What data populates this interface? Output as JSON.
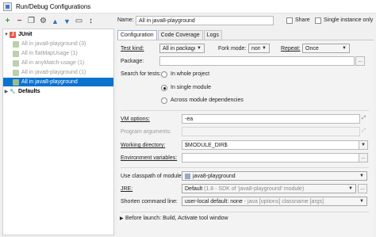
{
  "window": {
    "title": "Run/Debug Configurations"
  },
  "toolbar": {
    "add_glyph": "+",
    "remove_glyph": "−",
    "copy_glyph": "❐",
    "settings_glyph": "⚙",
    "up_glyph": "▲",
    "down_glyph": "▼",
    "folder_glyph": "▭",
    "sort_glyph": "↕"
  },
  "tree": {
    "junit_label": "JUnit",
    "items": [
      "All in java8-playground (3)",
      "All in flatMapUsage (1)",
      "All in anyMatch-usage (1)",
      "All in java8-playground (1)",
      "All in java8-playground"
    ],
    "defaults_label": "Defaults"
  },
  "header": {
    "name_label": "Name:",
    "name_value": "All in java8-playground",
    "share_label": "Share",
    "single_instance_label": "Single instance only"
  },
  "tabs": [
    "Configuration",
    "Code Coverage",
    "Logs"
  ],
  "config": {
    "test_kind_label": "Test kind:",
    "test_kind_value": "All in package",
    "fork_mode_label": "Fork mode:",
    "fork_mode_value": "none",
    "repeat_label": "Repeat:",
    "repeat_value": "Once",
    "package_label": "Package:",
    "package_value": "",
    "search_label": "Search for tests:",
    "search_options": [
      "In whole project",
      "In single module",
      "Across module dependencies"
    ],
    "vm_options_label": "VM options:",
    "vm_options_value": "-ea",
    "program_args_label": "Program arguments:",
    "program_args_value": "",
    "working_dir_label": "Working directory:",
    "working_dir_value": "$MODULE_DIR$",
    "env_vars_label": "Environment variables:",
    "env_vars_value": "",
    "classpath_label": "Use classpath of module:",
    "classpath_value": "java8-playground",
    "jre_label": "JRE:",
    "jre_value": "Default",
    "jre_hint": "(1.8 - SDK of 'java8-playground' module)",
    "shorten_label": "Shorten command line:",
    "shorten_value": "user-local default: none",
    "shorten_hint": "- java [options] classname [args]",
    "before_launch_label": "Before launch: Build, Activate tool window"
  },
  "colors": {
    "selection": "#0a72cf",
    "tab_active_border": "#9fb6d6"
  }
}
